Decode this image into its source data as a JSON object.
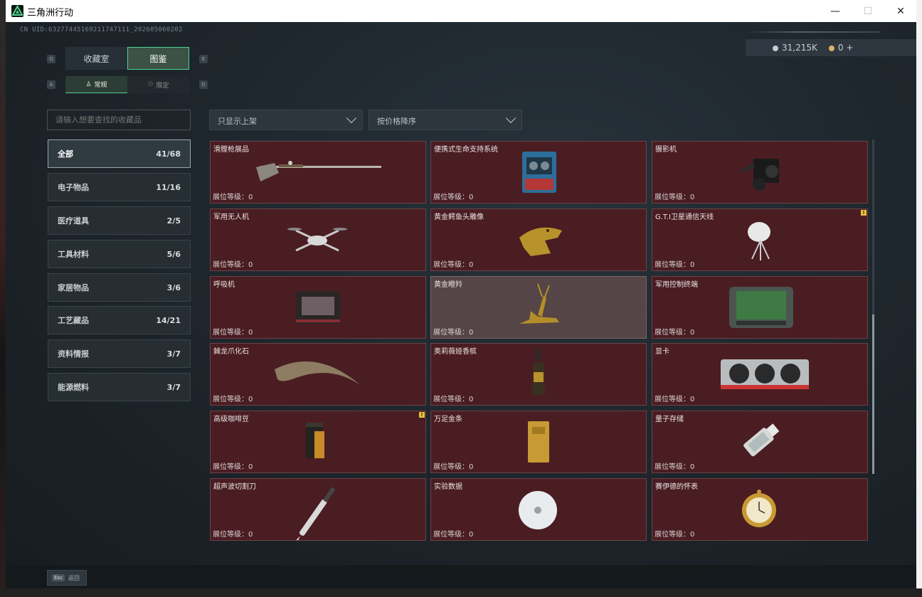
{
  "window": {
    "title": "三角洲行动"
  },
  "uid": "CN UID:63277445169211747111_202605060202",
  "currency": [
    {
      "value": "31,215K",
      "color": "#c9ccd0"
    },
    {
      "value": "0",
      "color": "#d9b36a",
      "add": "+"
    }
  ],
  "keys": {
    "tab_prev": "Q",
    "tab_next": "E",
    "sub_prev": "A",
    "sub_next": "D"
  },
  "tabs": [
    {
      "label": "收藏室",
      "active": false
    },
    {
      "label": "图鉴",
      "active": true
    }
  ],
  "subtabs": [
    {
      "label": "常规",
      "icon": "trophy-icon",
      "active": true
    },
    {
      "label": "限定",
      "icon": "limited-icon",
      "active": false
    }
  ],
  "search": {
    "placeholder": "请输入想要查找的收藏品"
  },
  "filters": {
    "shelf": "只显示上架",
    "sort": "按价格降序"
  },
  "categories": [
    {
      "label": "全部",
      "count": "41/68",
      "active": true
    },
    {
      "label": "电子物品",
      "count": "11/16"
    },
    {
      "label": "医疗道具",
      "count": "2/5"
    },
    {
      "label": "工具材料",
      "count": "5/6"
    },
    {
      "label": "家居物品",
      "count": "3/6"
    },
    {
      "label": "工艺藏品",
      "count": "14/21"
    },
    {
      "label": "资料情报",
      "count": "3/7"
    },
    {
      "label": "能源燃料",
      "count": "3/7"
    }
  ],
  "level_label": "展位等级：",
  "items": [
    {
      "name": "滑膛枪展品",
      "level": "0",
      "icon": "musket-icon"
    },
    {
      "name": "便携式生命支持系统",
      "level": "0",
      "icon": "life-support-icon"
    },
    {
      "name": "摄影机",
      "level": "0",
      "icon": "camera-icon"
    },
    {
      "name": "军用无人机",
      "level": "0",
      "icon": "drone-icon"
    },
    {
      "name": "黄金鳄鱼头雕像",
      "level": "0",
      "icon": "croc-statue-icon"
    },
    {
      "name": "G.T.I卫星通信天线",
      "level": "0",
      "icon": "satellite-dish-icon",
      "badge": "!"
    },
    {
      "name": "呼吸机",
      "level": "0",
      "icon": "ventilator-icon"
    },
    {
      "name": "黄金瞪羚",
      "level": "0",
      "icon": "gazelle-icon",
      "highlight": true
    },
    {
      "name": "军用控制终端",
      "level": "0",
      "icon": "terminal-icon"
    },
    {
      "name": "棘龙爪化石",
      "level": "0",
      "icon": "claw-fossil-icon"
    },
    {
      "name": "奥莉薇娅香槟",
      "level": "0",
      "icon": "champagne-icon"
    },
    {
      "name": "显卡",
      "level": "0",
      "icon": "gpu-icon"
    },
    {
      "name": "高级咖啡豆",
      "level": "0",
      "icon": "coffee-bag-icon",
      "badge": "!"
    },
    {
      "name": "万足金条",
      "level": "0",
      "icon": "gold-bar-icon"
    },
    {
      "name": "量子存储",
      "level": "0",
      "icon": "usb-drive-icon"
    },
    {
      "name": "超声波切割刀",
      "level": "0",
      "icon": "scalpel-icon"
    },
    {
      "name": "实验数据",
      "level": "0",
      "icon": "disc-icon"
    },
    {
      "name": "赛伊德的怀表",
      "level": "0",
      "icon": "pocket-watch-icon"
    }
  ],
  "footer": {
    "key": "Esc",
    "label": "返回"
  }
}
